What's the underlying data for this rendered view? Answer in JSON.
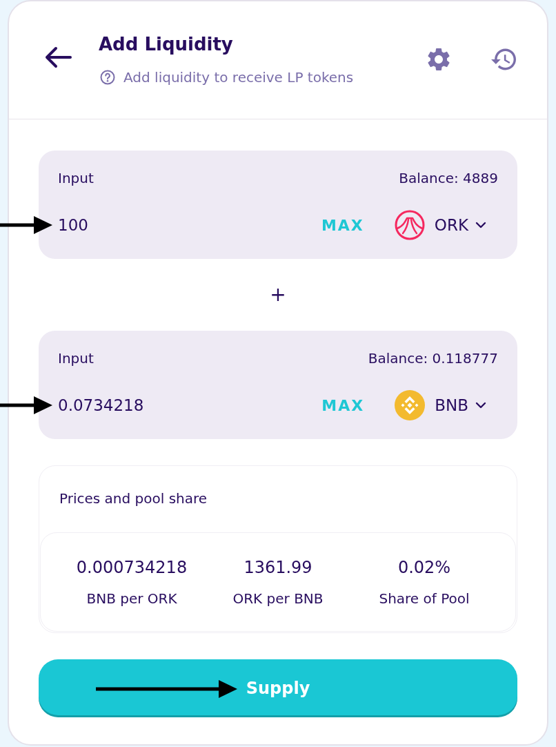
{
  "header": {
    "title": "Add Liquidity",
    "subtitle": "Add liquidity to receive LP tokens"
  },
  "inputs": [
    {
      "label": "Input",
      "balance": "Balance: 4889",
      "amount": "100",
      "max_label": "MAX",
      "token": {
        "symbol": "ORK",
        "kind": "ork"
      },
      "arrow": true
    },
    {
      "label": "Input",
      "balance": "Balance: 0.118777",
      "amount": "0.0734218",
      "max_label": "MAX",
      "token": {
        "symbol": "BNB",
        "kind": "bnb"
      },
      "arrow": true
    }
  ],
  "plus": "+",
  "prices": {
    "title": "Prices and pool share",
    "stats": [
      {
        "value": "0.000734218",
        "label": "BNB per ORK"
      },
      {
        "value": "1361.99",
        "label": "ORK per BNB"
      },
      {
        "value": "0.02%",
        "label": "Share of Pool"
      }
    ]
  },
  "supply_button": {
    "label": "Supply",
    "arrow": true
  }
}
